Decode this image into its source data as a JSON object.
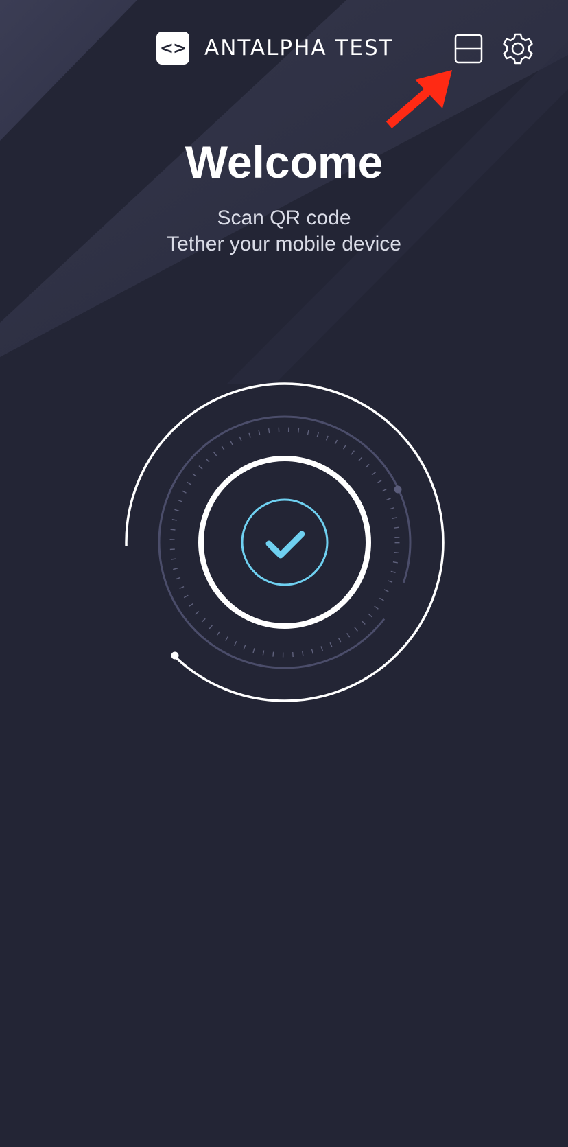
{
  "header": {
    "logo_glyph": "<>",
    "brand_name": "ANTALPHA TEST",
    "scan_icon": "scan-qr-icon",
    "settings_icon": "gear-icon"
  },
  "main": {
    "title": "Welcome",
    "subtitle_line1": "Scan QR code",
    "subtitle_line2": "Tether your mobile device",
    "status_icon": "checkmark-icon"
  },
  "colors": {
    "background": "#232535",
    "stripe_light": "#3b3d55",
    "accent": "#6fd0f0",
    "annotation": "#ff2a14",
    "ring_muted": "#4b4d6a"
  }
}
